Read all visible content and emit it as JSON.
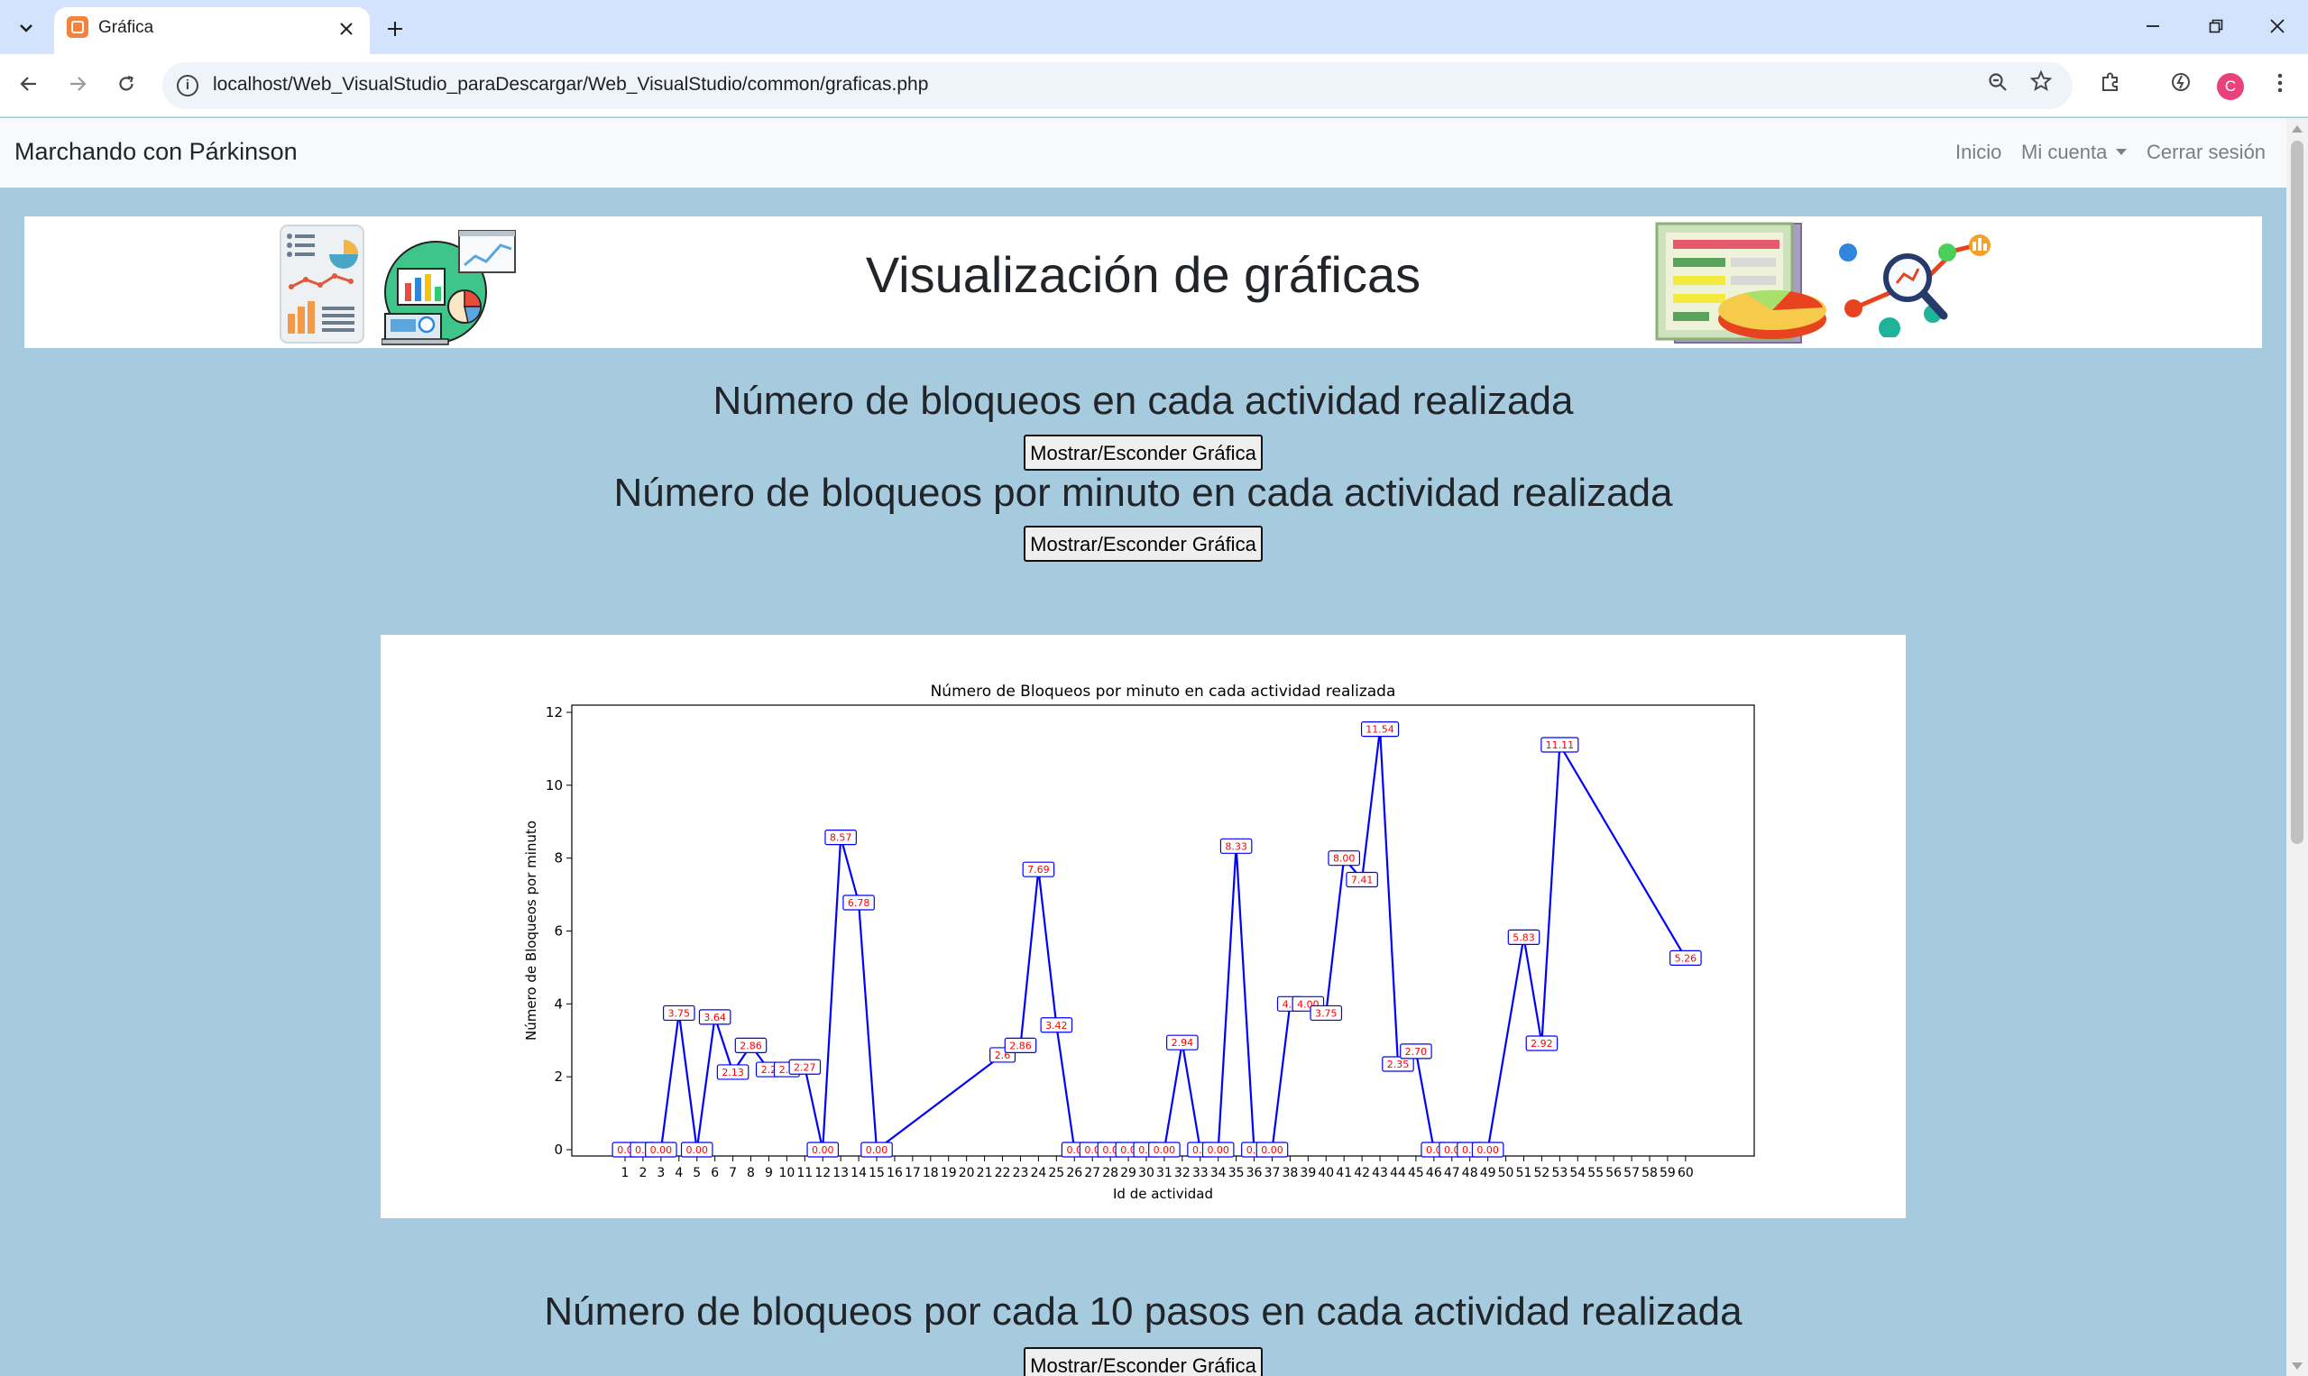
{
  "browser": {
    "tab_title": "Gráfica",
    "url": "localhost/Web_VisualStudio_paraDescargar/Web_VisualStudio/common/graficas.php",
    "avatar_letter": "C",
    "tab_list_icon": "chevron-down-icon",
    "close_icon": "close-icon",
    "new_tab_icon": "plus-icon",
    "minimize_icon": "minimize-icon",
    "restore_icon": "restore-icon",
    "window_close_icon": "window-close-icon",
    "back_icon": "arrow-left-icon",
    "forward_icon": "arrow-right-icon",
    "reload_icon": "reload-icon",
    "zoom_icon": "zoom-icon",
    "bookmark_icon": "star-icon",
    "extensions_icon": "puzzle-icon",
    "performance_icon": "speedometer-icon",
    "menu_icon": "kebab-menu-icon"
  },
  "navbar": {
    "brand": "Marchando con Párkinson",
    "inicio": "Inicio",
    "mi_cuenta": "Mi cuenta",
    "cerrar_sesion": "Cerrar sesión"
  },
  "header": {
    "title": "Visualización de gráficas"
  },
  "sections": [
    {
      "title": "Número de bloqueos en cada actividad realizada",
      "button_label": "Mostrar/Esconder Gráfica"
    },
    {
      "title": "Número de bloqueos por minuto en cada actividad realizada",
      "button_label": "Mostrar/Esconder Gráfica"
    },
    {
      "title": "Número de bloqueos por cada 10 pasos en cada actividad realizada",
      "button_label": "Mostrar/Esconder Gráfica"
    }
  ],
  "colors": {
    "page_background": "#a6cbde",
    "line": "#0000ff",
    "label_text": "#ff0000",
    "label_border": "#0000ff"
  },
  "chart_data": {
    "type": "line",
    "title": "Número de Bloqueos por minuto en cada actividad realizada",
    "xlabel": "Id de actividad",
    "ylabel": "Número de Bloqueos por minuto",
    "ylim": [
      0,
      12
    ],
    "yticks": [
      0,
      2,
      4,
      6,
      8,
      10,
      12
    ],
    "x_tick_labels": [
      "1",
      "2",
      "3",
      "4",
      "5",
      "6",
      "7",
      "8",
      "9",
      "10",
      "11",
      "12",
      "13",
      "14",
      "15",
      "16",
      "17",
      "18",
      "19",
      "20",
      "21",
      "22",
      "23",
      "24",
      "25",
      "26",
      "27",
      "28",
      "29",
      "30",
      "31",
      "32",
      "33",
      "34",
      "35",
      "36",
      "37",
      "38",
      "39",
      "40",
      "41",
      "42",
      "43",
      "44",
      "45",
      "46",
      "47",
      "48",
      "49",
      "50",
      "51",
      "52",
      "53",
      "54",
      "55",
      "56",
      "57",
      "58",
      "59",
      "60"
    ],
    "grid": false,
    "series": [
      {
        "x": [
          1,
          2,
          3,
          4,
          5,
          6,
          7,
          8,
          9,
          10,
          11,
          12,
          13,
          14,
          15,
          22,
          23,
          24,
          25,
          26,
          27,
          28,
          29,
          30,
          31,
          32,
          33,
          34,
          35,
          36,
          37,
          38,
          39,
          40,
          41,
          42,
          43,
          44,
          45,
          46,
          47,
          48,
          49,
          51,
          52,
          53,
          60
        ],
        "y": [
          0,
          0,
          0,
          3.75,
          0,
          3.64,
          2.13,
          2.86,
          2.2,
          2.2,
          2.27,
          0,
          8.57,
          6.78,
          0,
          2.6,
          2.86,
          7.69,
          3.42,
          0,
          0,
          0,
          0,
          0,
          0,
          2.94,
          0,
          0,
          8.33,
          0,
          0,
          4.0,
          4.0,
          3.75,
          8.0,
          7.41,
          11.54,
          2.35,
          2.7,
          0,
          0,
          0,
          0,
          5.83,
          2.92,
          11.11,
          5.26
        ],
        "labels": [
          "0.0",
          "0.0",
          "0.00",
          "3.75",
          "0.00",
          "3.64",
          "2.13",
          "2.86",
          "2.2",
          "2.2",
          "2.27",
          "0.00",
          "8.57",
          "6.78",
          "0.00",
          "2.6",
          "2.86",
          "7.69",
          "3.42",
          "0.0",
          "0.0",
          "0.0",
          "0.0",
          "0.0",
          "0.00",
          "2.94",
          "0.0",
          "0.00",
          "8.33",
          "0.0",
          "0.00",
          "4.0",
          "4.00",
          "3.75",
          "8.00",
          "7.41",
          "11.54",
          "2.35",
          "2.70",
          "0.0",
          "0.0",
          "0.0",
          "0.00",
          "5.83",
          "2.92",
          "11.11",
          "5.26"
        ]
      }
    ]
  }
}
